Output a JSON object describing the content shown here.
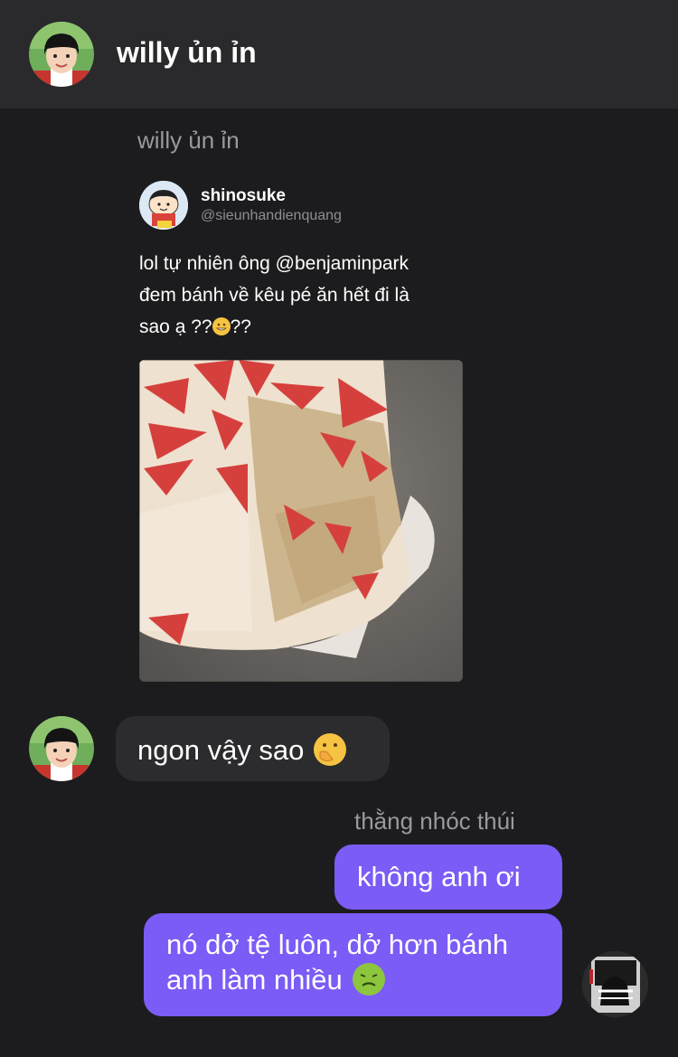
{
  "header": {
    "title": "willy ủn ỉn",
    "avatar_icon": "kid-avatar-icon"
  },
  "conversation": {
    "shared_post": {
      "sender_name": "willy ủn ỉn",
      "author_name": "shinosuke",
      "author_handle": "@sieunhandienquang",
      "text_line1": "lol tự nhiên ông @benjaminpark",
      "text_line2": "đem bánh về kêu pé ăn hết đi là",
      "text_line3_before": "sao ạ ??",
      "text_line3_after": "??",
      "emoji_icon": "grinning-face-icon",
      "image_icon": "strawberry-cake-image"
    },
    "incoming_message": {
      "text": "ngon vậy sao",
      "emoji_icon": "face-with-hand-over-mouth-icon"
    },
    "outgoing": {
      "sender_name": "thằng nhóc thúi",
      "message1": "không anh ơi",
      "message2": "nó dở tệ luôn, dở hơn bánh anh làm nhiều",
      "message2_emoji_icon": "nauseated-face-icon"
    }
  },
  "colors": {
    "background": "#1c1c1e",
    "header": "#2a2a2c",
    "incoming_bubble": "#2c2c2e",
    "outgoing_bubble": "#7b5cf6",
    "muted_text": "#9a9a9e"
  }
}
